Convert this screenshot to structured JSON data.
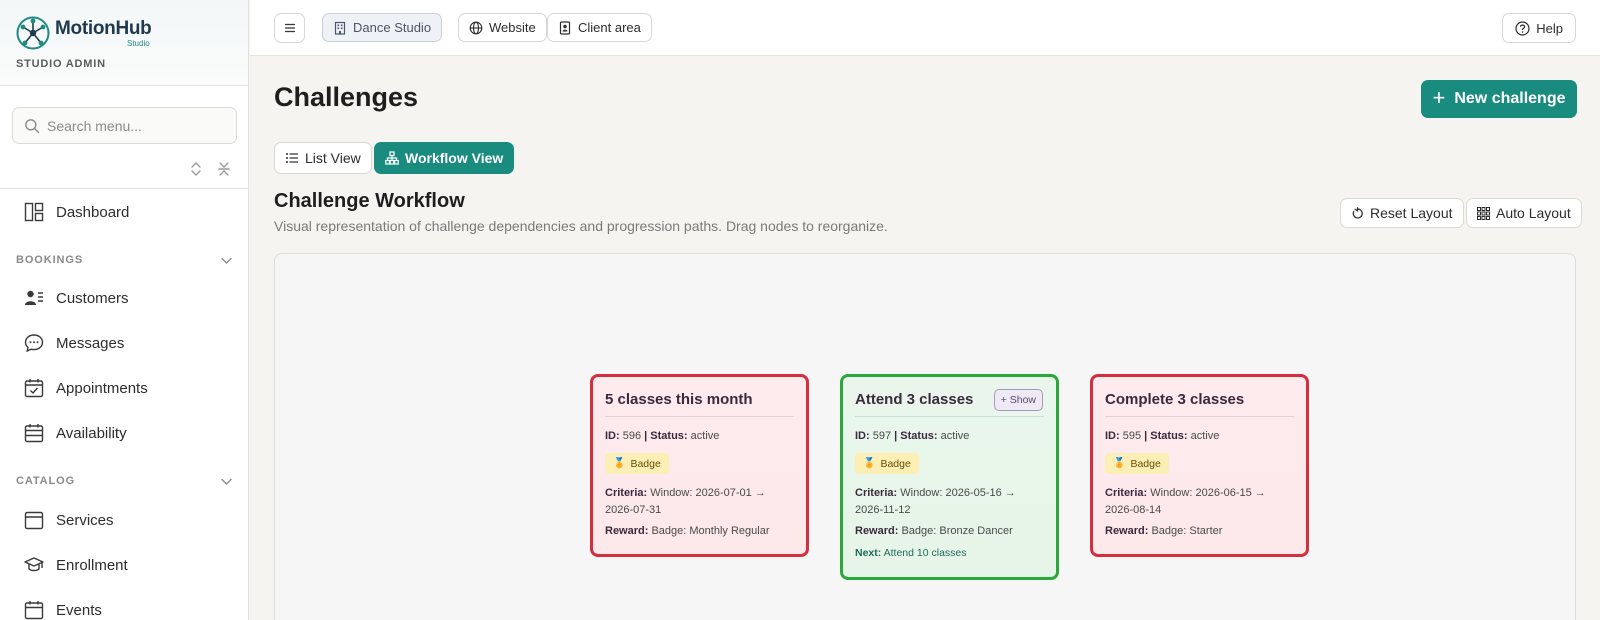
{
  "brand": {
    "name": "MotionHub",
    "sub": "Studio",
    "role": "STUDIO ADMIN"
  },
  "search": {
    "placeholder": "Search menu..."
  },
  "nav": {
    "dashboard": "Dashboard",
    "bookings_section": "BOOKINGS",
    "customers": "Customers",
    "messages": "Messages",
    "appointments": "Appointments",
    "availability": "Availability",
    "catalog_section": "CATALOG",
    "services": "Services",
    "enrollment": "Enrollment",
    "events": "Events"
  },
  "topbar": {
    "studio": "Dance Studio",
    "website": "Website",
    "client_area": "Client area",
    "help": "Help"
  },
  "page": {
    "title": "Challenges",
    "new_button": "New challenge",
    "list_view": "List View",
    "workflow_view": "Workflow View",
    "section_title": "Challenge Workflow",
    "section_sub": "Visual representation of challenge dependencies and progression paths. Drag nodes to reorganize.",
    "reset_layout": "Reset Layout",
    "auto_layout": "Auto Layout"
  },
  "nodes": [
    {
      "title": "5 classes this month",
      "id": "596",
      "status": "active",
      "badge": "Badge",
      "criteria": "Window: 2026-07-01 → 2026-07-31",
      "reward": "Badge: Monthly Regular",
      "color": "#d32f3f"
    },
    {
      "title": "Attend 3 classes",
      "show": "+ Show",
      "id": "597",
      "status": "active",
      "badge": "Badge",
      "criteria": "Window: 2026-05-16 → 2026-11-12",
      "reward": "Badge: Bronze Dancer",
      "next_label": "Next:",
      "next": "Attend 10 classes",
      "color": "#2aa83a"
    },
    {
      "title": "Complete 3 classes",
      "id": "595",
      "status": "active",
      "badge": "Badge",
      "criteria": "Window: 2026-06-15 → 2026-08-14",
      "reward": "Badge: Starter",
      "color": "#d32f3f"
    }
  ],
  "labels": {
    "id": "ID:",
    "status": "Status:",
    "criteria": "Criteria:",
    "reward": "Reward:",
    "sep": "|"
  },
  "colors": {
    "accent": "#1a8c7f",
    "inactive_border": "#d32f3f",
    "active_border": "#2aa83a"
  }
}
